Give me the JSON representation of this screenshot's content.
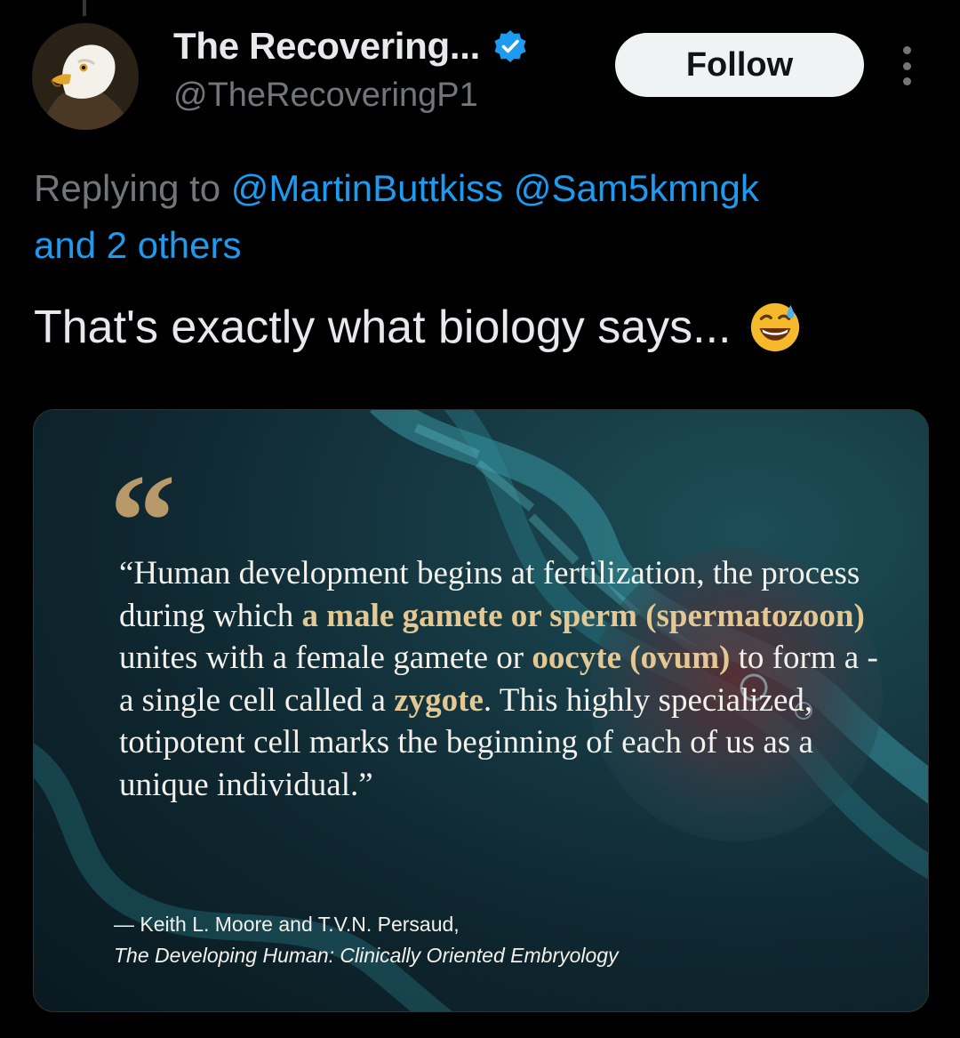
{
  "author": {
    "display_name": "The Recovering...",
    "handle": "@TheRecoveringP1",
    "verified": true,
    "avatar": "bald-eagle-icon"
  },
  "follow_label": "Follow",
  "more_icon": "more-vertical-icon",
  "reply_context": {
    "prefix": "Replying to",
    "mentions": [
      "@MartinButtkiss",
      "@Sam5kmngk"
    ],
    "others": "and 2 others"
  },
  "tweet": {
    "text": "That's exactly what biology says...",
    "emoji": "grinning-face-with-sweat-icon"
  },
  "media": {
    "open_quote": "“",
    "quote_segments": [
      {
        "text": "“Human development begins at fertilization, the process during which ",
        "hl": false
      },
      {
        "text": "a male gamete or sperm (spermatozoon)",
        "hl": true
      },
      {
        "text": " unites with a female gamete or ",
        "hl": false
      },
      {
        "text": "oocyte (ovum)",
        "hl": true
      },
      {
        "text": " to form a - a single cell called a ",
        "hl": false
      },
      {
        "text": "zygote",
        "hl": true
      },
      {
        "text": ". This highly specialized, totipotent cell marks the beginning of each of us as a unique individual.”",
        "hl": false
      }
    ],
    "attribution": "— Keith L. Moore and T.V.N. Persaud,",
    "book_title": "The Developing Human: Clinically Oriented Embryology",
    "highlight_color": "#e4c893"
  },
  "colors": {
    "background": "#000000",
    "link": "#1d9bf0",
    "secondary_text": "#71767b",
    "primary_text": "#e7e9ea",
    "follow_bg": "#eff3f4"
  }
}
